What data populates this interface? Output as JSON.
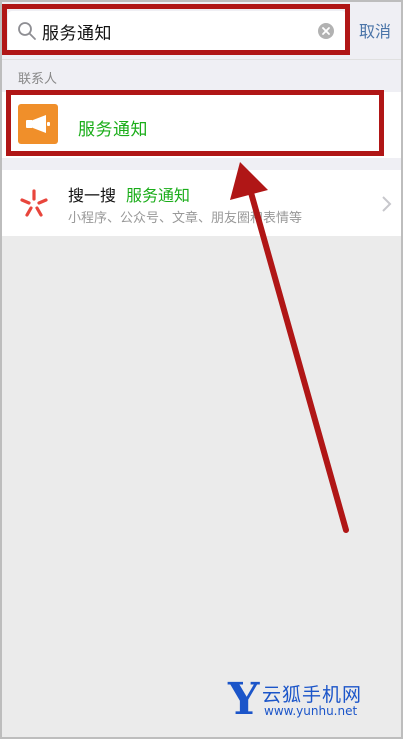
{
  "search": {
    "query": "服务通知",
    "cancel_label": "取消"
  },
  "results": {
    "section_label": "联系人",
    "contact_name": "服务通知"
  },
  "sousuo": {
    "title": "搜一搜",
    "keyword": "服务通知",
    "subtitle": "小程序、公众号、文章、朋友圈和表情等"
  },
  "watermark": {
    "logo_letter": "Y",
    "title": "云狐手机网",
    "url": "www.yunhu.net"
  },
  "colors": {
    "accent_green": "#1aad19",
    "highlight_red": "#b01616",
    "link_blue": "#4a74a8",
    "avatar_orange": "#f08f2a"
  },
  "icons": {
    "search": "search-icon",
    "clear": "clear-icon",
    "megaphone": "megaphone-icon",
    "sousuo": "sousuo-icon",
    "chevron": "chevron-right-icon"
  }
}
